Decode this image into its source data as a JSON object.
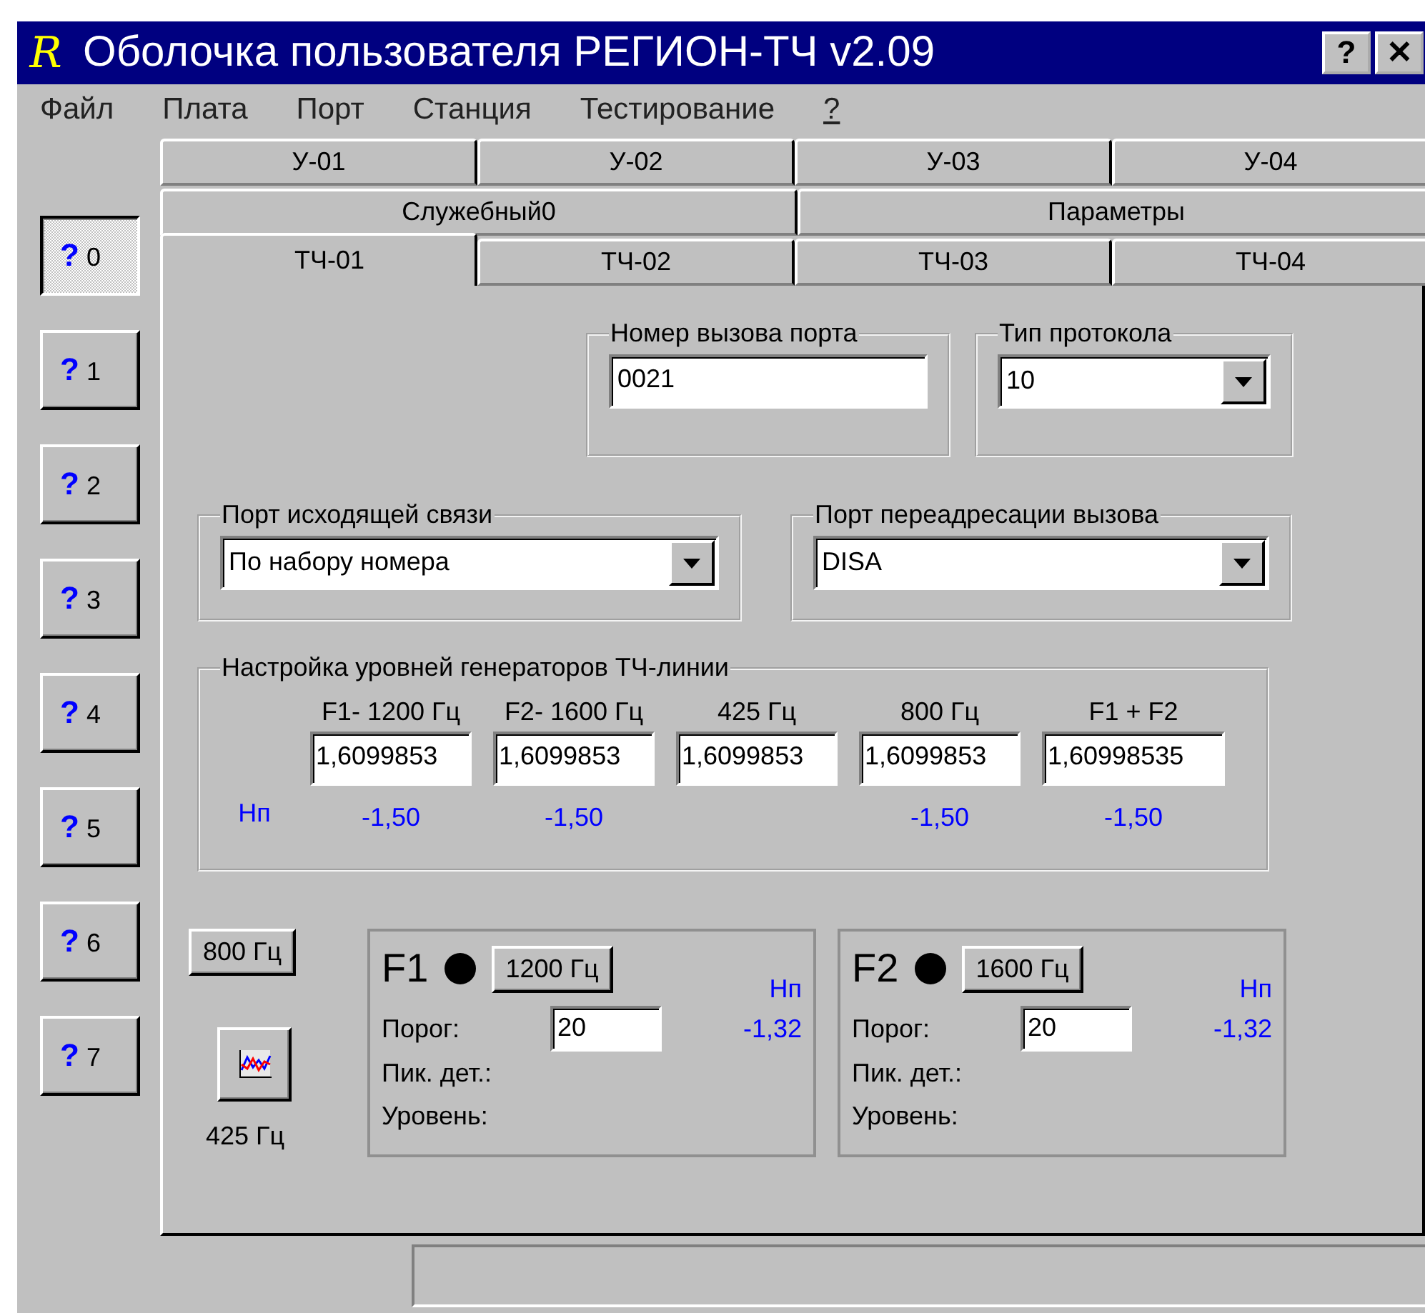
{
  "window": {
    "logo": "R",
    "title": "Оболочка пользователя РЕГИОН-ТЧ v2.09",
    "buttons": [
      "?",
      "✕"
    ]
  },
  "menu": [
    {
      "label": "Файл",
      "underlined": false
    },
    {
      "label": "Плата",
      "underlined": false
    },
    {
      "label": "Порт",
      "underlined": false
    },
    {
      "label": "Станция",
      "underlined": false
    },
    {
      "label": "Тестирование",
      "underlined": false
    },
    {
      "label": "?",
      "underlined": true
    }
  ],
  "side_buttons": [
    {
      "mark": "?",
      "label": "0",
      "selected": true
    },
    {
      "mark": "?",
      "label": "1",
      "selected": false
    },
    {
      "mark": "?",
      "label": "2",
      "selected": false
    },
    {
      "mark": "?",
      "label": "3",
      "selected": false
    },
    {
      "mark": "?",
      "label": "4",
      "selected": false
    },
    {
      "mark": "?",
      "label": "5",
      "selected": false
    },
    {
      "mark": "?",
      "label": "6",
      "selected": false
    },
    {
      "mark": "?",
      "label": "7",
      "selected": false
    }
  ],
  "tab_rows": [
    [
      {
        "label": "У-01",
        "selected": false
      },
      {
        "label": "У-02",
        "selected": false
      },
      {
        "label": "У-03",
        "selected": false
      },
      {
        "label": "У-04",
        "selected": false
      }
    ],
    [
      {
        "label": "Служебный0",
        "selected": false
      },
      {
        "label": "Параметры",
        "selected": false
      }
    ],
    [
      {
        "label": "ТЧ-01",
        "selected": true
      },
      {
        "label": "ТЧ-02",
        "selected": false
      },
      {
        "label": "ТЧ-03",
        "selected": false
      },
      {
        "label": "ТЧ-04",
        "selected": false
      }
    ]
  ],
  "call_number": {
    "legend": "Номер вызова порта",
    "value": "0021"
  },
  "protocol": {
    "legend": "Тип протокола",
    "value": "10"
  },
  "outgoing_port": {
    "legend": "Порт исходящей связи",
    "value": "По набору номера"
  },
  "redirect_port": {
    "legend": "Порт переадресации вызова",
    "value": "DISA"
  },
  "generators": {
    "legend": "Настройка уровней генераторов ТЧ-линии",
    "unit": "Нп",
    "columns": [
      {
        "label": "F1- 1200 Гц",
        "value": "1,6099853",
        "reading": "-1,50"
      },
      {
        "label": "F2- 1600 Гц",
        "value": "1,6099853",
        "reading": "-1,50"
      },
      {
        "label": "425 Гц",
        "value": "1,6099853"
      },
      {
        "label": "800 Гц",
        "value": "1,6099853",
        "reading": "-1,50"
      },
      {
        "label": "F1 + F2",
        "value": "1,60998535",
        "reading": "-1,50"
      }
    ]
  },
  "left_controls": {
    "button": "800 Гц",
    "caption": "425 Гц"
  },
  "detectors": [
    {
      "name": "F1",
      "button": "1200 Гц",
      "unit": "Нп",
      "reading": "-1,32",
      "threshold_label": "Порог:",
      "threshold": "20",
      "peak_label": "Пик. дет.:",
      "level_label": "Уровень:"
    },
    {
      "name": "F2",
      "button": "1600 Гц",
      "unit": "Нп",
      "reading": "-1,32",
      "threshold_label": "Порог:",
      "threshold": "20",
      "peak_label": "Пик. дет.:",
      "level_label": "Уровень:"
    }
  ]
}
